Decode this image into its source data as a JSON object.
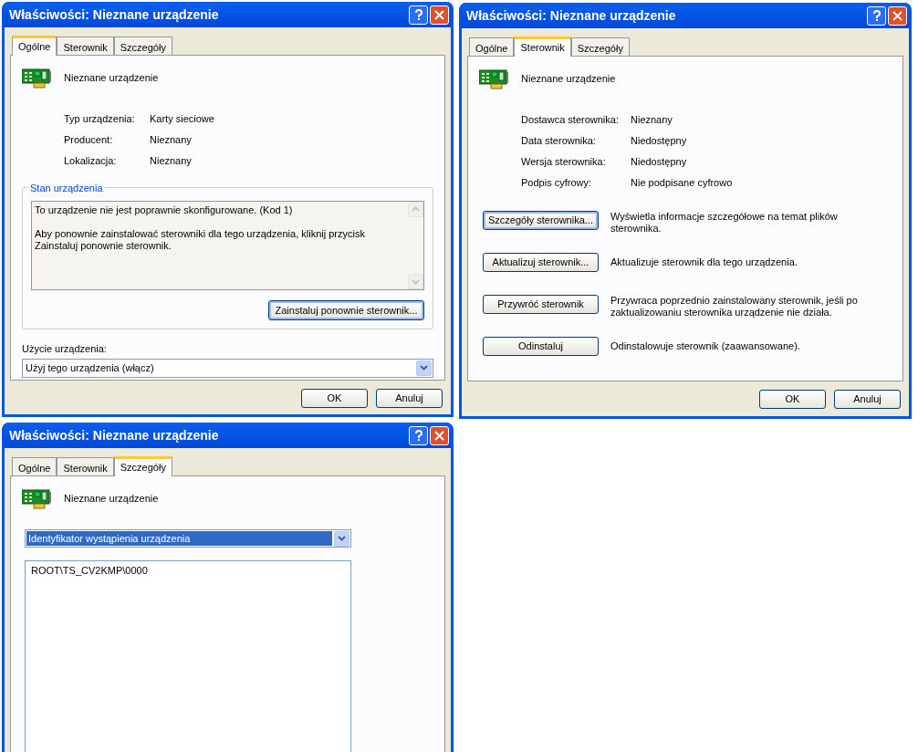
{
  "dialogs": [
    {
      "kind": "general",
      "title": "Właściwości: Nieznane urządzenie",
      "tabs": [
        {
          "label": "Ogólne",
          "selected": true
        },
        {
          "label": "Sterownik",
          "selected": false
        },
        {
          "label": "Szczegóły",
          "selected": false
        }
      ],
      "device_name": "Nieznane urządzenie",
      "properties": [
        {
          "label": "Typ urządzenia:",
          "value": "Karty sieciowe"
        },
        {
          "label": "Producent:",
          "value": "Nieznany"
        },
        {
          "label": "Lokalizacja:",
          "value": "Nieznany"
        }
      ],
      "status_group": {
        "title": "Stan urządzenia",
        "lines": [
          "To urządzenie nie jest poprawnie skonfigurowane. (Kod 1)",
          "Aby ponownie zainstalować sterowniki dla tego urządzenia, kliknij przycisk Zainstaluj ponownie sterownik."
        ],
        "button": "Zainstaluj ponownie sterownik..."
      },
      "usage": {
        "label": "Użycie urządzenia:",
        "value": "Użyj tego urządzenia (włącz)"
      },
      "buttons": [
        "OK",
        "Anuluj"
      ]
    },
    {
      "kind": "driver",
      "title": "Właściwości: Nieznane urządzenie",
      "tabs": [
        {
          "label": "Ogólne",
          "selected": false
        },
        {
          "label": "Sterownik",
          "selected": true
        },
        {
          "label": "Szczegóły",
          "selected": false
        }
      ],
      "device_name": "Nieznane urządzenie",
      "properties": [
        {
          "label": "Dostawca sterownika:",
          "value": "Nieznany"
        },
        {
          "label": "Data sterownika:",
          "value": "Niedostępny"
        },
        {
          "label": "Wersja sterownika:",
          "value": "Niedostępny"
        },
        {
          "label": "Podpis cyfrowy:",
          "value": "Nie podpisane cyfrowo"
        }
      ],
      "actions": [
        {
          "button": "Szczegóły sterownika...",
          "description": "Wyświetla informacje szczegółowe na temat plików sterownika.",
          "focused": true
        },
        {
          "button": "Aktualizuj sterownik...",
          "description": "Aktualizuje sterownik dla tego urządzenia.",
          "focused": false
        },
        {
          "button": "Przywróć sterownik",
          "description": "Przywraca poprzednio zainstalowany sterownik, jeśli po zaktualizowaniu sterownika urządzenie nie działa.",
          "focused": false
        },
        {
          "button": "Odinstaluj",
          "description": "Odinstalowuje sterownik (zaawansowane).",
          "focused": false
        }
      ],
      "buttons": [
        "OK",
        "Anuluj"
      ]
    },
    {
      "kind": "details",
      "title": "Właściwości: Nieznane urządzenie",
      "tabs": [
        {
          "label": "Ogólne",
          "selected": false
        },
        {
          "label": "Sterownik",
          "selected": false
        },
        {
          "label": "Szczegóły",
          "selected": true
        }
      ],
      "device_name": "Nieznane urządzenie",
      "property_select": {
        "value": "Identyfikator wystąpienia urządzenia",
        "focused": true
      },
      "values": [
        "ROOT\\TS_CV2KMP\\0000"
      ]
    }
  ]
}
